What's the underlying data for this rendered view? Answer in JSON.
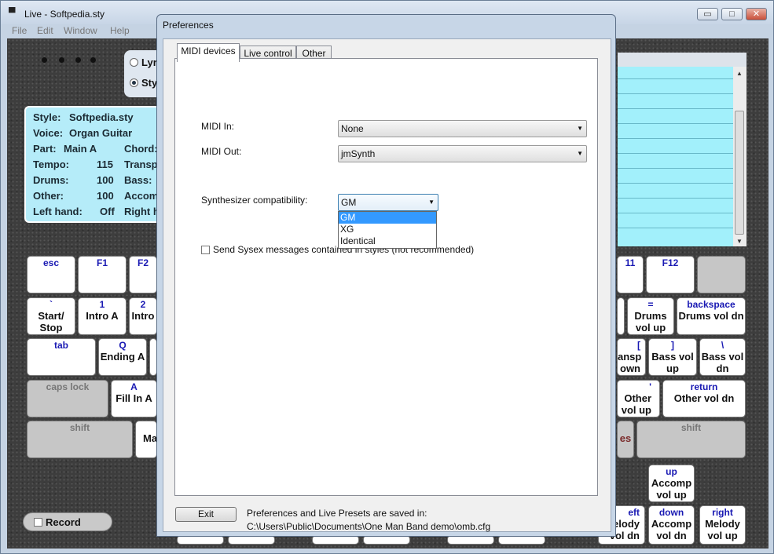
{
  "window": {
    "title": "Live - Softpedia.sty",
    "menu": [
      "File",
      "Edit",
      "Window",
      "Help"
    ],
    "controls": {
      "minimize": "▭",
      "maximize": "□",
      "close": "✕"
    }
  },
  "left_panel": {
    "modes": [
      {
        "label": "Lyr",
        "selected": false
      },
      {
        "label": "Sty",
        "selected": true
      }
    ],
    "info": {
      "style_label": "Style:",
      "style_value": "Softpedia.sty",
      "voice_label": "Voice:",
      "voice_value": "Organ Guitar",
      "part_label": "Part:",
      "part_value": "Main A",
      "chord_label": "Chord:",
      "tempo_label": "Tempo:",
      "tempo_value": "115",
      "transp_label": "Transp",
      "drums_label": "Drums:",
      "drums_value": "100",
      "bass_label": "Bass:",
      "other_label": "Other:",
      "other_value": "100",
      "accom_label": "Accom",
      "lefthand_label": "Left hand:",
      "lefthand_value": "Off",
      "righth_label": "Right h"
    },
    "record_label": "Record"
  },
  "keys": [
    {
      "id": "esc",
      "top": "esc",
      "bottom": ""
    },
    {
      "id": "f1",
      "top": "F1",
      "bottom": ""
    },
    {
      "id": "f2",
      "top": "F2",
      "bottom": ""
    },
    {
      "id": "f11",
      "top": "11",
      "bottom": ""
    },
    {
      "id": "f12",
      "top": "F12",
      "bottom": ""
    },
    {
      "id": "blank",
      "top": "",
      "bottom": ""
    },
    {
      "id": "backtick",
      "top": "`",
      "bottom": "Start/ Stop"
    },
    {
      "id": "k1",
      "top": "1",
      "bottom": "Intro A"
    },
    {
      "id": "k2",
      "top": "2",
      "bottom": "Intro"
    },
    {
      "id": "dash",
      "top": "-",
      "bottom": ""
    },
    {
      "id": "equals",
      "top": "=",
      "bottom": "Drums vol up"
    },
    {
      "id": "backspace",
      "top": "backspace",
      "bottom": "Drums vol dn"
    },
    {
      "id": "tab",
      "top": "tab",
      "bottom": ""
    },
    {
      "id": "q",
      "top": "Q",
      "bottom": "Ending A"
    },
    {
      "id": "w",
      "top": "",
      "bottom": ""
    },
    {
      "id": "p",
      "top": "[",
      "bottom": "ansp own"
    },
    {
      "id": "rbracket",
      "top": "]",
      "bottom": "Bass vol up"
    },
    {
      "id": "backslash",
      "top": "\\",
      "bottom": "Bass vol dn"
    },
    {
      "id": "capslock",
      "top": "caps lock",
      "bottom": ""
    },
    {
      "id": "a",
      "top": "A",
      "bottom": "Fill In A"
    },
    {
      "id": "quote",
      "top": "'",
      "bottom": "Other vol up"
    },
    {
      "id": "return",
      "top": "return",
      "bottom": "Other vol dn"
    },
    {
      "id": "lshift",
      "top": "shift",
      "bottom": ""
    },
    {
      "id": "z",
      "top": "",
      "bottom": "Ma"
    },
    {
      "id": "slash",
      "top": "",
      "bottom": "es"
    },
    {
      "id": "rshift",
      "top": "shift",
      "bottom": ""
    },
    {
      "id": "up",
      "top": "up",
      "bottom": "Accomp vol up"
    },
    {
      "id": "left",
      "top": "eft",
      "bottom": "elody vol dn"
    },
    {
      "id": "down",
      "top": "down",
      "bottom": "Accomp vol dn"
    },
    {
      "id": "right",
      "top": "right",
      "bottom": "Melody vol up"
    },
    {
      "id": "bottom1",
      "top": "",
      "bottom": ""
    },
    {
      "id": "bottom2",
      "top": "",
      "bottom": ""
    },
    {
      "id": "bottom3",
      "top": "",
      "bottom": ""
    },
    {
      "id": "bottom4",
      "top": "",
      "bottom": ""
    },
    {
      "id": "bottom5",
      "top": "",
      "bottom": ""
    },
    {
      "id": "bottom6",
      "top": "",
      "bottom": ""
    }
  ],
  "dialog": {
    "title": "Preferences",
    "tabs": [
      "MIDI devices",
      "Live control",
      "Other"
    ],
    "active_tab": "MIDI devices",
    "midi_in_label": "MIDI In:",
    "midi_in_value": "None",
    "midi_out_label": "MIDI Out:",
    "midi_out_value": "jmSynth",
    "synth_label": "Synthesizer compatibility:",
    "synth_value": "GM",
    "synth_options": [
      "GM",
      "XG",
      "Identical"
    ],
    "sysex_label": "Send Sysex messages contained in styles (not recommended)",
    "exit_label": "Exit",
    "saved_label": "Preferences and Live Presets are saved in:",
    "saved_path": "C:\\Users\\Public\\Documents\\One Man Band demo\\omb.cfg"
  }
}
